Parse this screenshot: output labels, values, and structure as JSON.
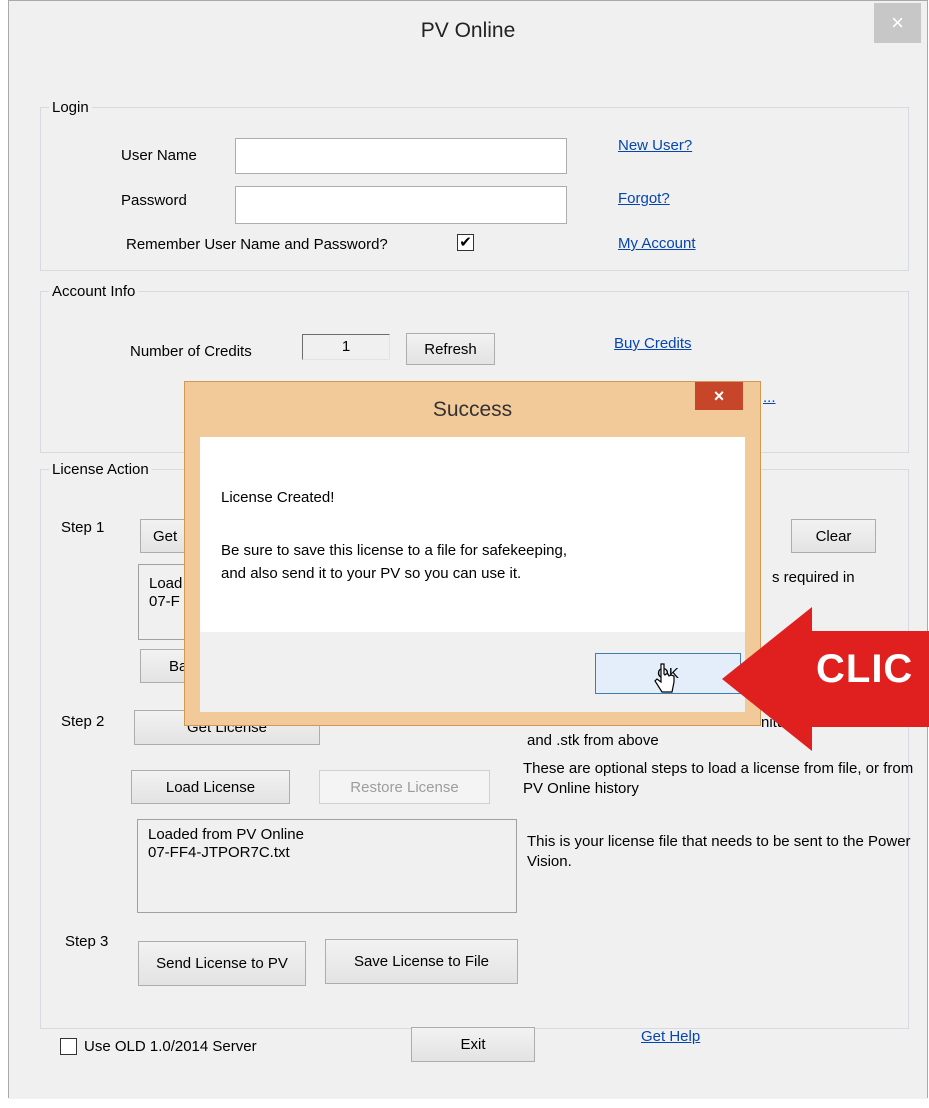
{
  "window": {
    "title": "PV Online",
    "close_glyph": "×"
  },
  "login": {
    "legend": "Login",
    "username_label": "User Name",
    "username_value": "",
    "password_label": "Password",
    "password_value": "",
    "remember_label": "Remember User Name and Password?",
    "remember_checked": true,
    "new_user_link": "New User?",
    "forgot_link": "Forgot?",
    "my_account_link": "My Account"
  },
  "account": {
    "legend": "Account Info",
    "credits_label": "Number of Credits",
    "credits_value": "1",
    "refresh_button": "Refresh",
    "buy_credits_link": "Buy Credits",
    "partial_link": "..."
  },
  "license": {
    "legend": "License Action",
    "step1_label": "Step 1",
    "get_button_partial": "Get",
    "clear_button": "Clear",
    "step1_box_lines": [
      "Load",
      "07-F"
    ],
    "step1_note_partial": "s required in",
    "back_button_partial": "Ba",
    "step2_label": "Step 2",
    "get_license_button": "Get License",
    "step2_note_partial": "nitu",
    "step2_note_line2": "and .stk from above",
    "load_license_button": "Load License",
    "restore_license_button": "Restore License",
    "optional_note": "These are optional steps to load a license from file, or from PV Online history",
    "loaded_box_line1": "Loaded from PV Online",
    "loaded_box_line2": "07-FF4-JTPOR7C.txt",
    "license_file_note": "This is your license file that needs to be sent to the Power Vision.",
    "step3_label": "Step 3",
    "send_button": "Send License to PV",
    "save_button": "Save License to File"
  },
  "footer": {
    "old_server_label": "Use OLD 1.0/2014 Server",
    "old_server_checked": false,
    "exit_button": "Exit",
    "get_help_link": "Get Help"
  },
  "dialog": {
    "title": "Success",
    "close_glyph": "×",
    "message_line1": "License Created!",
    "message_line2": "Be sure to save this license to a file for safekeeping,",
    "message_line3": "and also send it to your PV so you can use it.",
    "ok_button": "OK"
  },
  "callout": {
    "text": "CLIC",
    "color": "#e0201f"
  },
  "colors": {
    "window_bg": "#f0f0f0",
    "link": "#0645ad",
    "dialog_frame": "#f2c999",
    "dialog_close": "#c7462a"
  }
}
